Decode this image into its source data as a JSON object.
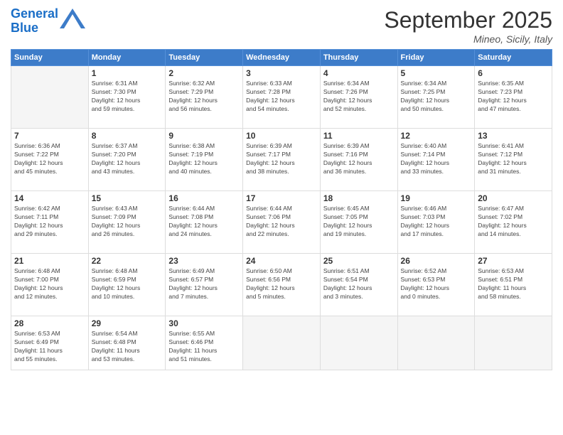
{
  "logo": {
    "line1": "General",
    "line2": "Blue"
  },
  "title": "September 2025",
  "location": "Mineo, Sicily, Italy",
  "days_of_week": [
    "Sunday",
    "Monday",
    "Tuesday",
    "Wednesday",
    "Thursday",
    "Friday",
    "Saturday"
  ],
  "weeks": [
    [
      {
        "day": "",
        "info": ""
      },
      {
        "day": "1",
        "info": "Sunrise: 6:31 AM\nSunset: 7:30 PM\nDaylight: 12 hours\nand 59 minutes."
      },
      {
        "day": "2",
        "info": "Sunrise: 6:32 AM\nSunset: 7:29 PM\nDaylight: 12 hours\nand 56 minutes."
      },
      {
        "day": "3",
        "info": "Sunrise: 6:33 AM\nSunset: 7:28 PM\nDaylight: 12 hours\nand 54 minutes."
      },
      {
        "day": "4",
        "info": "Sunrise: 6:34 AM\nSunset: 7:26 PM\nDaylight: 12 hours\nand 52 minutes."
      },
      {
        "day": "5",
        "info": "Sunrise: 6:34 AM\nSunset: 7:25 PM\nDaylight: 12 hours\nand 50 minutes."
      },
      {
        "day": "6",
        "info": "Sunrise: 6:35 AM\nSunset: 7:23 PM\nDaylight: 12 hours\nand 47 minutes."
      }
    ],
    [
      {
        "day": "7",
        "info": "Sunrise: 6:36 AM\nSunset: 7:22 PM\nDaylight: 12 hours\nand 45 minutes."
      },
      {
        "day": "8",
        "info": "Sunrise: 6:37 AM\nSunset: 7:20 PM\nDaylight: 12 hours\nand 43 minutes."
      },
      {
        "day": "9",
        "info": "Sunrise: 6:38 AM\nSunset: 7:19 PM\nDaylight: 12 hours\nand 40 minutes."
      },
      {
        "day": "10",
        "info": "Sunrise: 6:39 AM\nSunset: 7:17 PM\nDaylight: 12 hours\nand 38 minutes."
      },
      {
        "day": "11",
        "info": "Sunrise: 6:39 AM\nSunset: 7:16 PM\nDaylight: 12 hours\nand 36 minutes."
      },
      {
        "day": "12",
        "info": "Sunrise: 6:40 AM\nSunset: 7:14 PM\nDaylight: 12 hours\nand 33 minutes."
      },
      {
        "day": "13",
        "info": "Sunrise: 6:41 AM\nSunset: 7:12 PM\nDaylight: 12 hours\nand 31 minutes."
      }
    ],
    [
      {
        "day": "14",
        "info": "Sunrise: 6:42 AM\nSunset: 7:11 PM\nDaylight: 12 hours\nand 29 minutes."
      },
      {
        "day": "15",
        "info": "Sunrise: 6:43 AM\nSunset: 7:09 PM\nDaylight: 12 hours\nand 26 minutes."
      },
      {
        "day": "16",
        "info": "Sunrise: 6:44 AM\nSunset: 7:08 PM\nDaylight: 12 hours\nand 24 minutes."
      },
      {
        "day": "17",
        "info": "Sunrise: 6:44 AM\nSunset: 7:06 PM\nDaylight: 12 hours\nand 22 minutes."
      },
      {
        "day": "18",
        "info": "Sunrise: 6:45 AM\nSunset: 7:05 PM\nDaylight: 12 hours\nand 19 minutes."
      },
      {
        "day": "19",
        "info": "Sunrise: 6:46 AM\nSunset: 7:03 PM\nDaylight: 12 hours\nand 17 minutes."
      },
      {
        "day": "20",
        "info": "Sunrise: 6:47 AM\nSunset: 7:02 PM\nDaylight: 12 hours\nand 14 minutes."
      }
    ],
    [
      {
        "day": "21",
        "info": "Sunrise: 6:48 AM\nSunset: 7:00 PM\nDaylight: 12 hours\nand 12 minutes."
      },
      {
        "day": "22",
        "info": "Sunrise: 6:48 AM\nSunset: 6:59 PM\nDaylight: 12 hours\nand 10 minutes."
      },
      {
        "day": "23",
        "info": "Sunrise: 6:49 AM\nSunset: 6:57 PM\nDaylight: 12 hours\nand 7 minutes."
      },
      {
        "day": "24",
        "info": "Sunrise: 6:50 AM\nSunset: 6:56 PM\nDaylight: 12 hours\nand 5 minutes."
      },
      {
        "day": "25",
        "info": "Sunrise: 6:51 AM\nSunset: 6:54 PM\nDaylight: 12 hours\nand 3 minutes."
      },
      {
        "day": "26",
        "info": "Sunrise: 6:52 AM\nSunset: 6:53 PM\nDaylight: 12 hours\nand 0 minutes."
      },
      {
        "day": "27",
        "info": "Sunrise: 6:53 AM\nSunset: 6:51 PM\nDaylight: 11 hours\nand 58 minutes."
      }
    ],
    [
      {
        "day": "28",
        "info": "Sunrise: 6:53 AM\nSunset: 6:49 PM\nDaylight: 11 hours\nand 55 minutes."
      },
      {
        "day": "29",
        "info": "Sunrise: 6:54 AM\nSunset: 6:48 PM\nDaylight: 11 hours\nand 53 minutes."
      },
      {
        "day": "30",
        "info": "Sunrise: 6:55 AM\nSunset: 6:46 PM\nDaylight: 11 hours\nand 51 minutes."
      },
      {
        "day": "",
        "info": ""
      },
      {
        "day": "",
        "info": ""
      },
      {
        "day": "",
        "info": ""
      },
      {
        "day": "",
        "info": ""
      }
    ]
  ]
}
